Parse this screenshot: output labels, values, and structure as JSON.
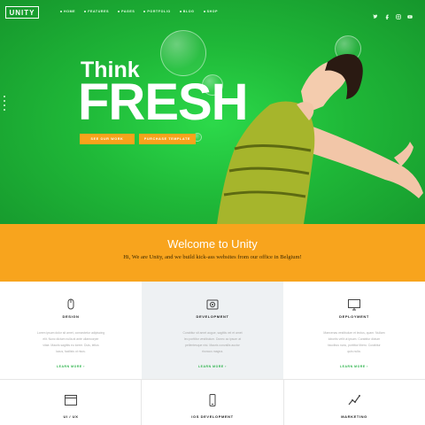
{
  "header": {
    "logo": "UNITY",
    "nav": [
      "HOME",
      "FEATURES",
      "PAGES",
      "PORTFOLIO",
      "BLOG",
      "SHOP"
    ]
  },
  "hero": {
    "line1": "Think",
    "line2": "FRESH",
    "button1": "SEE OUR WORK",
    "button2": "PURCHASE TEMPLATE"
  },
  "welcome": {
    "title": "Welcome to Unity",
    "subtitle": "Hi, We are Unity, and we build kick-ass websites from our office in Belgium!"
  },
  "services": [
    {
      "title": "DESIGN",
      "desc1": "Lorem ipsum dolor sit amet, consectetur adipiscing",
      "desc2": "elit. Nunc dictum nulla at ante ullamcorper",
      "desc3": "vitae. Mauris sagittis eu lorem. Duis, tellus",
      "desc4": "lacus, facilisis ut risus.",
      "more": "LEARN MORE"
    },
    {
      "title": "DEVELOPMENT",
      "desc1": "Curabitur sit amet augue, sagittis vel et amet",
      "desc2": "leo porttitor vestibulum. Donec ac ipsum at",
      "desc3": "pellentesque nisi. Mauris convallis auctor",
      "desc4": "rhoncus magna.",
      "more": "LEARN MORE"
    },
    {
      "title": "DEPLOYMENT",
      "desc1": "Maecenas vestibulum et lectus, quam. Nullam",
      "desc2": "lobortis velit ut ipsum. Curabitur dictum",
      "desc3": "faucibus nunc, porttitor libero. Curabitur",
      "desc4": "quis nulla.",
      "more": "LEARN MORE"
    },
    {
      "title": "UI / UX"
    },
    {
      "title": "IOS DEVELOPMENT"
    },
    {
      "title": "MARKETING"
    }
  ],
  "colors": {
    "green": "#1fb838",
    "orange": "#f8a41d",
    "accent_green": "#2bb34a"
  },
  "icons": [
    "mouse-icon",
    "camera-icon",
    "monitor-icon",
    "browser-window-icon",
    "phone-icon",
    "chart-icon"
  ]
}
